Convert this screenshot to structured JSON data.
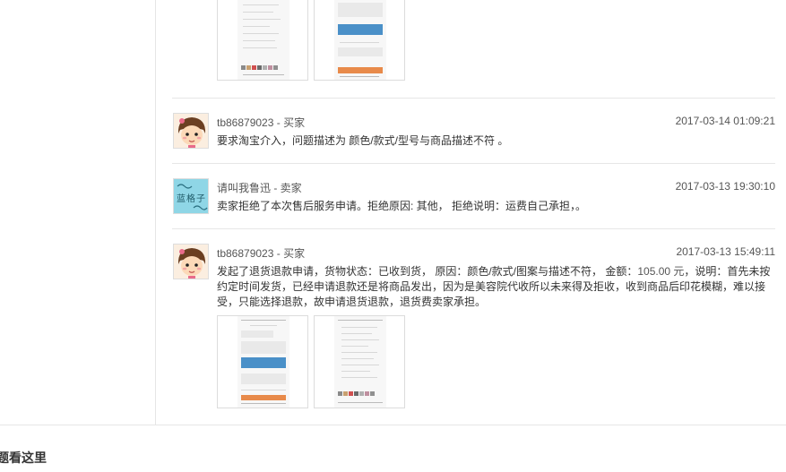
{
  "entries": [
    {
      "user": "tb86879023 - 买家",
      "time": "2017-03-14 01:09:21",
      "message": "要求淘宝介入，问题描述为 颜色/款式/型号与商品描述不符 。",
      "avatar_icon": "cartoon-girl-avatar-icon"
    },
    {
      "user": "请叫我鲁迅 - 卖家",
      "time": "2017-03-13 19:30:10",
      "message": "卖家拒绝了本次售后服务申请。拒绝原因: 其他， 拒绝说明：运费自己承担，。",
      "avatar_icon": "calligraphy-avatar-icon",
      "avatar_text": "蓝格子"
    },
    {
      "user": "tb86879023 - 买家",
      "time": "2017-03-13 15:49:11",
      "message_pre": "发起了退货退款申请，货物状态：已收到货， 原因：颜色/款式/图案与描述不符， 金额：",
      "amount": "105.00 元",
      "message_post": "，说明：首先未按约定时间发货，已经申请退款还是将商品发出，因为是美容院代收所以未来得及拒收，收到商品后印花模糊，难以接受，只能选择退款，故申请退货退款，退货费卖家承担。",
      "avatar_icon": "cartoon-girl-avatar-icon"
    }
  ],
  "footer": {
    "title": "题看这里"
  },
  "colors": {
    "blue_bubble": "#4a90c8",
    "orange_bar": "#e88a4a",
    "divider": "#e6e6e6"
  }
}
